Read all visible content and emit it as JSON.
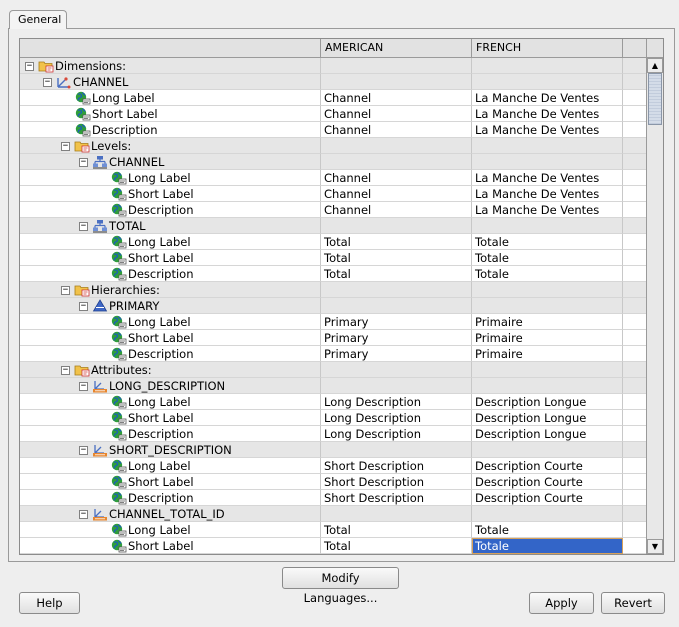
{
  "tab": {
    "label": "General"
  },
  "table": {
    "columns": [
      "",
      "AMERICAN",
      "FRENCH"
    ],
    "rows": [
      {
        "level": 0,
        "toggle": "minus",
        "icon": "folder-icon",
        "label": "Dimensions:",
        "american": "",
        "french": "",
        "group": true
      },
      {
        "level": 1,
        "toggle": "minus",
        "icon": "dimension-icon",
        "label": "CHANNEL",
        "american": "",
        "french": "",
        "group": true
      },
      {
        "level": 2,
        "toggle": "",
        "icon": "globe-icon",
        "label": "Long Label",
        "american": "Channel",
        "french": "La Manche De Ventes",
        "group": false
      },
      {
        "level": 2,
        "toggle": "",
        "icon": "globe-icon",
        "label": "Short Label",
        "american": "Channel",
        "french": "La Manche De Ventes",
        "group": false
      },
      {
        "level": 2,
        "toggle": "",
        "icon": "globe-icon",
        "label": "Description",
        "american": "Channel",
        "french": "La Manche De Ventes",
        "group": false
      },
      {
        "level": 2,
        "toggle": "minus",
        "icon": "folder-icon",
        "label": "Levels:",
        "american": "",
        "french": "",
        "group": true
      },
      {
        "level": 3,
        "toggle": "minus",
        "icon": "level-icon",
        "label": "CHANNEL",
        "american": "",
        "french": "",
        "group": true
      },
      {
        "level": 4,
        "toggle": "",
        "icon": "globe-icon",
        "label": "Long Label",
        "american": "Channel",
        "french": "La Manche De Ventes",
        "group": false
      },
      {
        "level": 4,
        "toggle": "",
        "icon": "globe-icon",
        "label": "Short Label",
        "american": "Channel",
        "french": "La Manche De Ventes",
        "group": false
      },
      {
        "level": 4,
        "toggle": "",
        "icon": "globe-icon",
        "label": "Description",
        "american": "Channel",
        "french": "La Manche De Ventes",
        "group": false
      },
      {
        "level": 3,
        "toggle": "minus",
        "icon": "level-icon",
        "label": "TOTAL",
        "american": "",
        "french": "",
        "group": true
      },
      {
        "level": 4,
        "toggle": "",
        "icon": "globe-icon",
        "label": "Long Label",
        "american": "Total",
        "french": "Totale",
        "group": false
      },
      {
        "level": 4,
        "toggle": "",
        "icon": "globe-icon",
        "label": "Short Label",
        "american": "Total",
        "french": "Totale",
        "group": false
      },
      {
        "level": 4,
        "toggle": "",
        "icon": "globe-icon",
        "label": "Description",
        "american": "Total",
        "french": "Totale",
        "group": false
      },
      {
        "level": 2,
        "toggle": "minus",
        "icon": "folder-icon",
        "label": "Hierarchies:",
        "american": "",
        "french": "",
        "group": true
      },
      {
        "level": 3,
        "toggle": "minus",
        "icon": "hierarchy-icon",
        "label": "PRIMARY",
        "american": "",
        "french": "",
        "group": true
      },
      {
        "level": 4,
        "toggle": "",
        "icon": "globe-icon",
        "label": "Long Label",
        "american": "Primary",
        "french": "Primaire",
        "group": false
      },
      {
        "level": 4,
        "toggle": "",
        "icon": "globe-icon",
        "label": "Short Label",
        "american": "Primary",
        "french": "Primaire",
        "group": false
      },
      {
        "level": 4,
        "toggle": "",
        "icon": "globe-icon",
        "label": "Description",
        "american": "Primary",
        "french": "Primaire",
        "group": false
      },
      {
        "level": 2,
        "toggle": "minus",
        "icon": "folder-icon",
        "label": "Attributes:",
        "american": "",
        "french": "",
        "group": true
      },
      {
        "level": 3,
        "toggle": "minus",
        "icon": "attribute-icon",
        "label": "LONG_DESCRIPTION",
        "american": "",
        "french": "",
        "group": true
      },
      {
        "level": 4,
        "toggle": "",
        "icon": "globe-icon",
        "label": "Long Label",
        "american": "Long Description",
        "french": "Description Longue",
        "group": false
      },
      {
        "level": 4,
        "toggle": "",
        "icon": "globe-icon",
        "label": "Short Label",
        "american": "Long Description",
        "french": "Description Longue",
        "group": false
      },
      {
        "level": 4,
        "toggle": "",
        "icon": "globe-icon",
        "label": "Description",
        "american": "Long Description",
        "french": "Description Longue",
        "group": false
      },
      {
        "level": 3,
        "toggle": "minus",
        "icon": "attribute-icon",
        "label": "SHORT_DESCRIPTION",
        "american": "",
        "french": "",
        "group": true
      },
      {
        "level": 4,
        "toggle": "",
        "icon": "globe-icon",
        "label": "Long Label",
        "american": "Short Description",
        "french": "Description Courte",
        "group": false
      },
      {
        "level": 4,
        "toggle": "",
        "icon": "globe-icon",
        "label": "Short Label",
        "american": "Short Description",
        "french": "Description Courte",
        "group": false
      },
      {
        "level": 4,
        "toggle": "",
        "icon": "globe-icon",
        "label": "Description",
        "american": "Short Description",
        "french": "Description Courte",
        "group": false
      },
      {
        "level": 3,
        "toggle": "minus",
        "icon": "attribute-icon",
        "label": "CHANNEL_TOTAL_ID",
        "american": "",
        "french": "",
        "group": true
      },
      {
        "level": 4,
        "toggle": "",
        "icon": "globe-icon",
        "label": "Long Label",
        "american": "Total",
        "french": "Totale",
        "group": false
      },
      {
        "level": 4,
        "toggle": "",
        "icon": "globe-icon",
        "label": "Short Label",
        "american": "Total",
        "french": "Totale",
        "group": false,
        "selected": true
      }
    ]
  },
  "buttons": {
    "modify_languages": "Modify Languages...",
    "help": "Help",
    "apply": "Apply",
    "revert": "Revert"
  },
  "colors": {
    "selection": "#3365c8",
    "group_row": "#e6e6e6",
    "globe_green": "#2f9e3a",
    "globe_blue": "#3a66c4"
  }
}
